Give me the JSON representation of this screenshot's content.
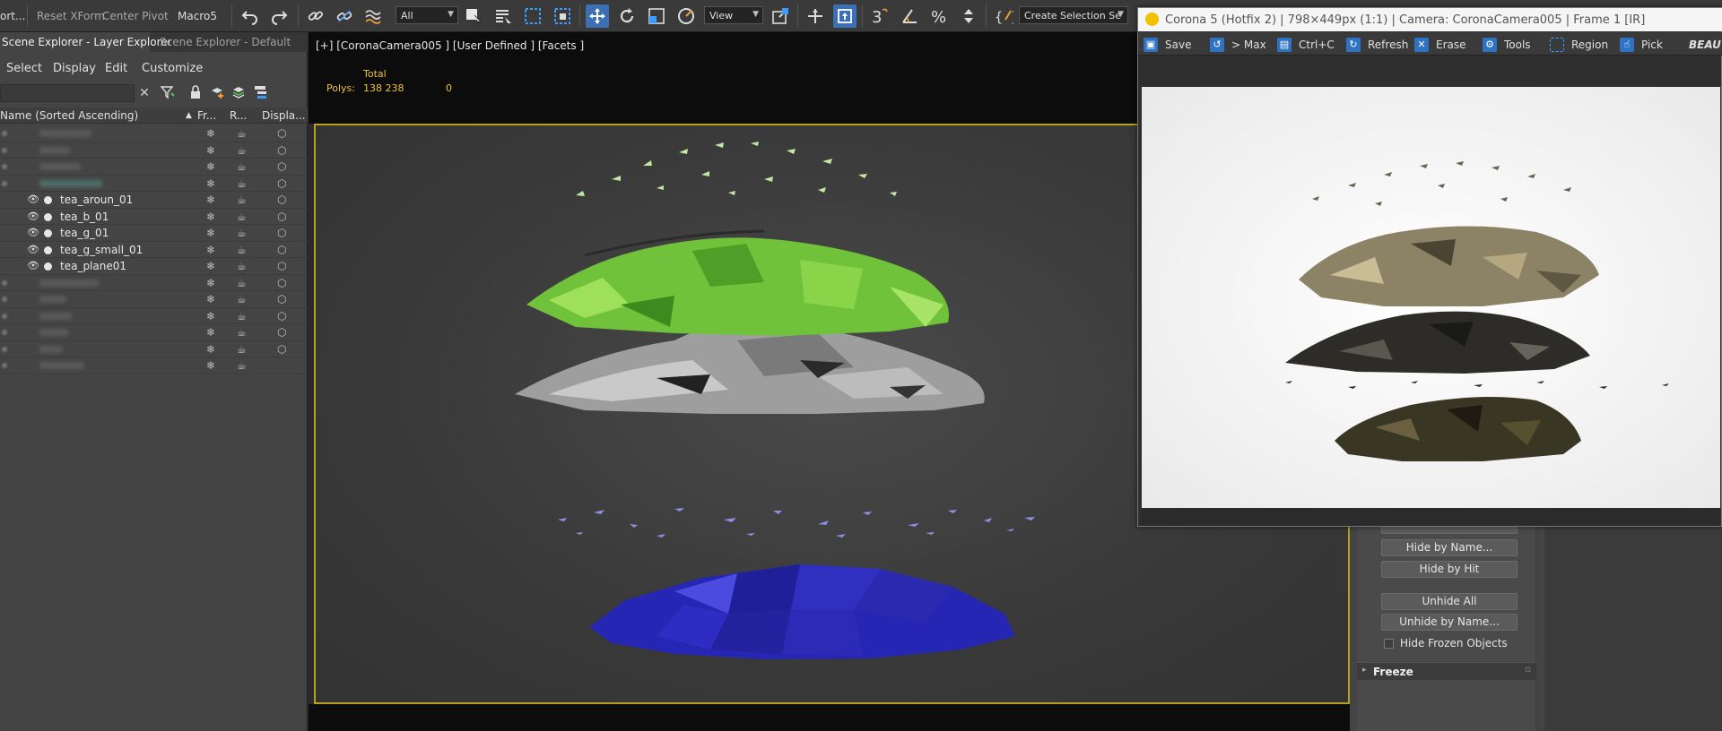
{
  "toolbar": {
    "left_text": "ort...",
    "reset_xform": "Reset XForm",
    "center_pivot": "Center Pivot",
    "macro": "Macro5",
    "selection_filter": "All",
    "ref_coord": "View",
    "named_selection": "Create Selection Se"
  },
  "scene_explorer": {
    "tab_active": "Scene Explorer - Layer Explorer",
    "tab_inactive": "Scene Explorer - Default",
    "menu": [
      "Select",
      "Display",
      "Edit",
      "Customize"
    ],
    "columns": {
      "name": "Name (Sorted Ascending)",
      "frozen": "Fr...",
      "render": "R...",
      "display": "Displa..."
    },
    "layers": [
      {
        "label": "tea_aroun_01"
      },
      {
        "label": "tea_b_01"
      },
      {
        "label": "tea_g_01"
      },
      {
        "label": "tea_g_small_01"
      },
      {
        "label": "tea_plane01"
      }
    ],
    "col_glyphs": {
      "frozen": "❄",
      "render": "☕",
      "display": "⬡"
    }
  },
  "viewport": {
    "label": "[+] [CoronaCamera005 ] [User Defined ] [Facets ]",
    "stats_total": "Total",
    "stats_polys_label": "Polys:",
    "stats_polys_value": "138 238",
    "stats_polys_sel": "0"
  },
  "command_panel": {
    "hide_by_name": "Hide by Name...",
    "hide_by_hit": "Hide by Hit",
    "unhide_all": "Unhide All",
    "unhide_by_name": "Unhide by Name...",
    "hide_frozen": "Hide Frozen Objects",
    "freeze_rollout": "Freeze"
  },
  "corona": {
    "title": "Corona 5 (Hotfix 2) | 798×449px (1:1) | Camera: CoronaCamera005 | Frame 1 [IR]",
    "tools": {
      "save": "Save",
      "max": "> Max",
      "copy": "Ctrl+C",
      "refresh": "Refresh",
      "erase": "Erase",
      "tools": "Tools",
      "region": "Region",
      "pick": "Pick",
      "beau": "BEAU"
    }
  }
}
